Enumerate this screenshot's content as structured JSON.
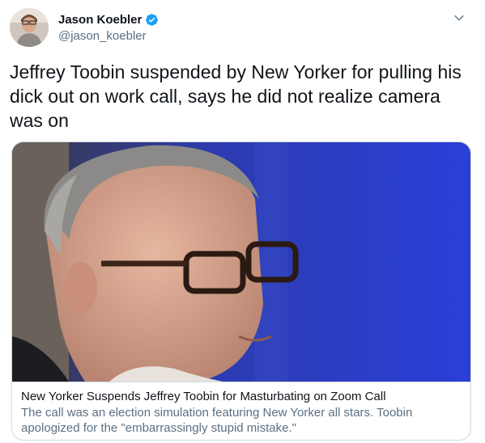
{
  "author": {
    "display_name": "Jason Koebler",
    "handle": "@jason_koebler",
    "verified": true,
    "avatar_icon": "avatar-photo",
    "verified_icon": "verified-badge-icon",
    "menu_icon": "chevron-down-icon"
  },
  "tweet": {
    "text": "Jeffrey Toobin suspended by New Yorker for pulling his dick out on work call, says he did not realize camera was on"
  },
  "card": {
    "image_icon": "article-photo",
    "title": "New Yorker Suspends Jeffrey Toobin for Masturbating on Zoom Call",
    "description": "The call was an election simulation featuring New Yorker all stars. Toobin apologized for the \"embarrassingly stupid mistake.\""
  },
  "colors": {
    "verified_blue": "#1da1f2",
    "secondary_text": "#5b7083",
    "border": "#cfd9de",
    "background_blue": "#2a3fd8"
  }
}
